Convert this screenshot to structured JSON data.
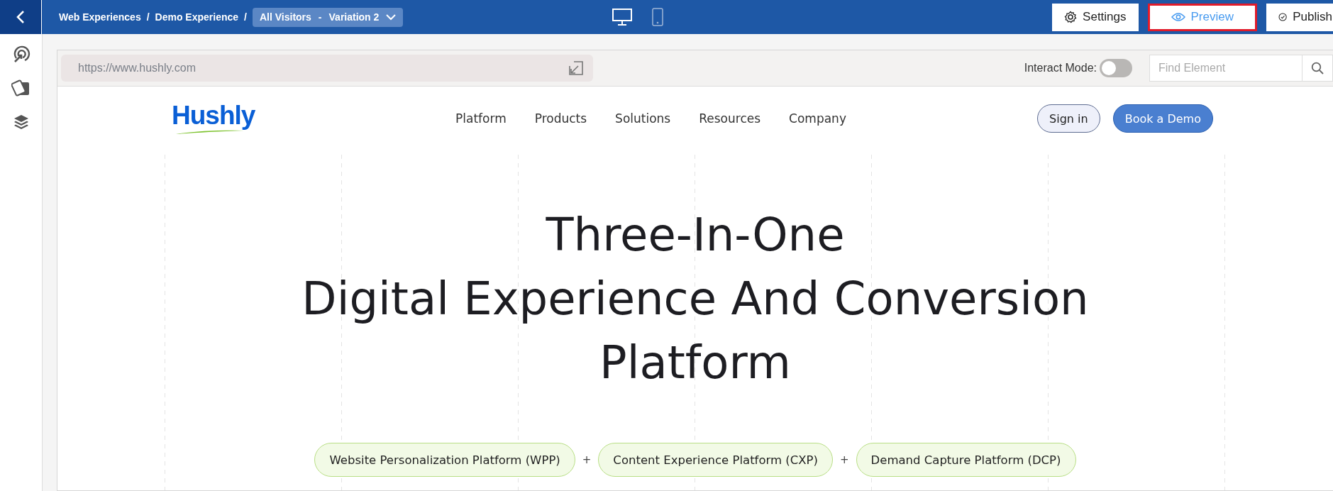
{
  "top_bar": {
    "breadcrumb": [
      "Web Experiences",
      "Demo Experience"
    ],
    "separator": "/",
    "variation": {
      "audience": "All Visitors",
      "dash": "-",
      "name": "Variation 2"
    },
    "devices": [
      {
        "kind": "desktop",
        "selected": true
      },
      {
        "kind": "mobile",
        "selected": false
      }
    ],
    "buttons": [
      {
        "kind": "settings",
        "label": "Settings",
        "selected": false
      },
      {
        "kind": "preview",
        "label": "Preview",
        "selected": true
      },
      {
        "kind": "publish",
        "label": "Publish",
        "selected": false
      }
    ]
  },
  "sidebar": {
    "items": [
      {
        "kind": "target"
      },
      {
        "kind": "cards"
      },
      {
        "kind": "layers"
      }
    ]
  },
  "browser": {
    "url": "https://www.hushly.com",
    "interact_mode": {
      "label": "Interact Mode",
      "colon": ":",
      "on": false
    },
    "find": {
      "placeholder": "Find Element"
    }
  },
  "site": {
    "logo": "Hushly",
    "nav": [
      "Platform",
      "Products",
      "Solutions",
      "Resources",
      "Company"
    ],
    "sign_in": "Sign in",
    "demo": "Book a Demo",
    "heading": [
      "Three-In-One",
      "Digital Experience And Conversion",
      "Platform"
    ],
    "pills": [
      "Website Personalization Platform (WPP)",
      "Content Experience Platform (CXP)",
      "Demand Capture Platform (DCP)"
    ],
    "plus": "+"
  }
}
